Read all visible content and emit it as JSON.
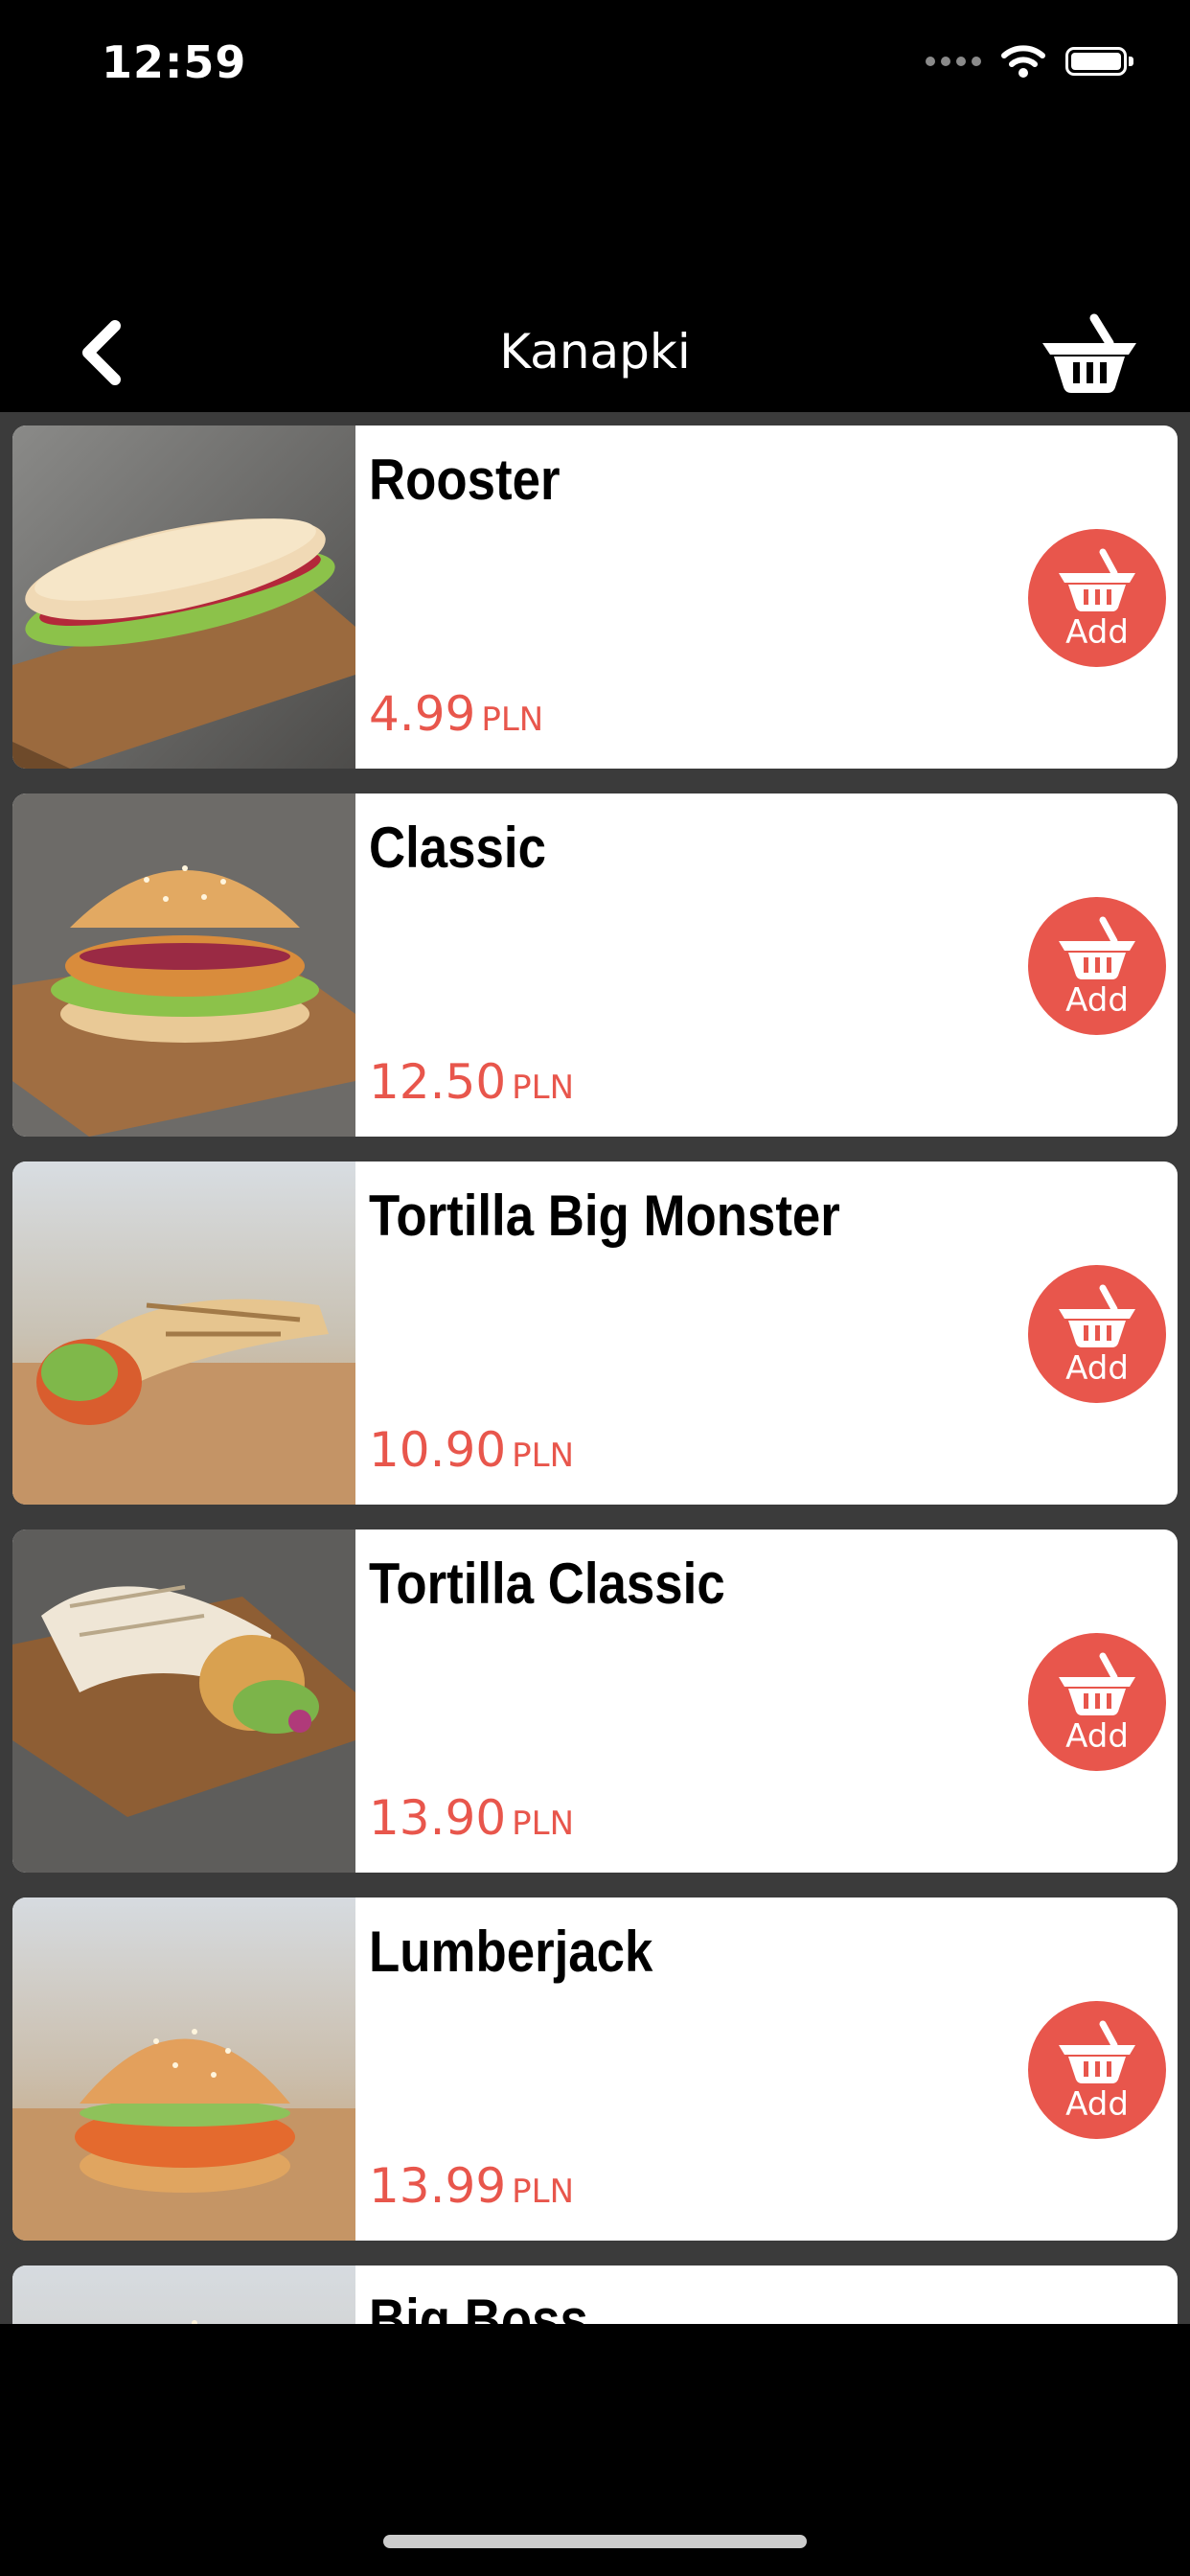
{
  "status_bar": {
    "time": "12:59"
  },
  "nav": {
    "title": "Kanapki"
  },
  "products": [
    {
      "name": "Rooster",
      "price": "4.99",
      "currency": "PLN",
      "add_label": "Add"
    },
    {
      "name": "Classic",
      "price": "12.50",
      "currency": "PLN",
      "add_label": "Add"
    },
    {
      "name": "Tortilla Big Monster",
      "price": "10.90",
      "currency": "PLN",
      "add_label": "Add"
    },
    {
      "name": "Tortilla Classic",
      "price": "13.90",
      "currency": "PLN",
      "add_label": "Add"
    },
    {
      "name": "Lumberjack",
      "price": "13.99",
      "currency": "PLN",
      "add_label": "Add"
    },
    {
      "name": "Big Boss"
    }
  ],
  "colors": {
    "accent": "#e8564c",
    "list_background": "#3b3b3b",
    "nav_background": "#000000"
  }
}
